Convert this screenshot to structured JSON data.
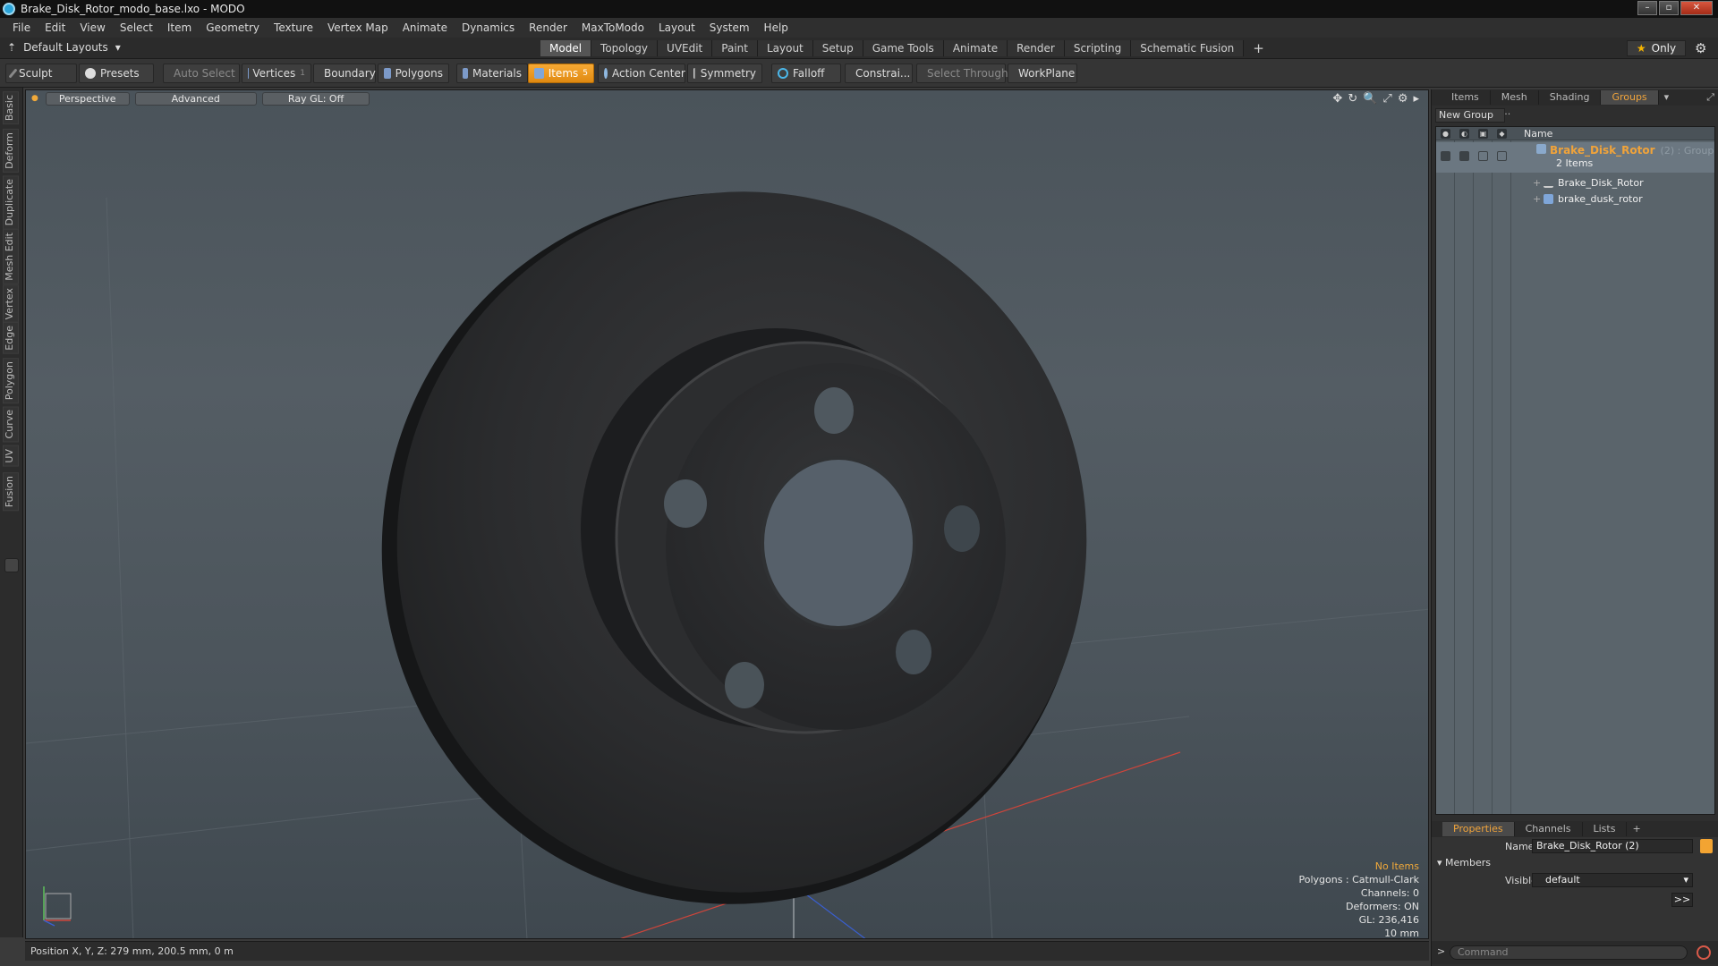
{
  "window": {
    "title": "Brake_Disk_Rotor_modo_base.lxo - MODO",
    "controls": [
      "–",
      "▫",
      "✕"
    ]
  },
  "menu": [
    "File",
    "Edit",
    "View",
    "Select",
    "Item",
    "Geometry",
    "Texture",
    "Vertex Map",
    "Animate",
    "Dynamics",
    "Render",
    "MaxToModo",
    "Layout",
    "System",
    "Help"
  ],
  "layout_bar": {
    "layouts_label": "Default Layouts",
    "tabs": [
      "Model",
      "Topology",
      "UVEdit",
      "Paint",
      "Layout",
      "Setup",
      "Game Tools",
      "Animate",
      "Render",
      "Scripting",
      "Schematic Fusion"
    ],
    "active_tab": "Model",
    "plus": "+",
    "only_label": "Only",
    "gear": "⚙"
  },
  "toolbar": {
    "sculpt": "Sculpt",
    "presets": "Presets",
    "auto_select": "Auto Select",
    "vertices": "Vertices",
    "vertices_count": "1",
    "boundary": "Boundary",
    "polygons": "Polygons",
    "materials": "Materials",
    "items": "Items",
    "items_count": "5",
    "action_center": "Action Center",
    "symmetry": "Symmetry",
    "falloff": "Falloff",
    "constraints": "Constrai...",
    "select_through": "Select Through",
    "workplane": "WorkPlane"
  },
  "left_tabs": [
    "Basic",
    "Deform",
    "Duplicate",
    "Mesh Edit",
    "Vertex",
    "Edge",
    "Polygon",
    "Curve",
    "UV",
    "Fusion"
  ],
  "viewport": {
    "view_label": "Perspective",
    "advanced_label": "Advanced",
    "raygl_label": "Ray GL: Off",
    "tools": [
      "✥",
      "↻",
      "🔍",
      "⤢",
      "⚙",
      "▸"
    ],
    "info": {
      "selection": "No Items",
      "polygons": "Polygons : Catmull-Clark",
      "channels": "Channels: 0",
      "deformers": "Deformers: ON",
      "gl": "GL: 236,416",
      "scale": "10 mm"
    },
    "colors": {
      "accent": "#f0a93a"
    }
  },
  "statusbar": {
    "position": "Position X, Y, Z:   279 mm, 200.5 mm, 0 m"
  },
  "right_panel": {
    "tabs": [
      "Items",
      "Mesh ...",
      "Shading",
      "Groups"
    ],
    "active_tab": "Groups",
    "new_group": "New Group",
    "name_header": "Name",
    "group": {
      "name": "Brake_Disk_Rotor",
      "suffix": "(2) : Group",
      "count": "2 Items",
      "children": [
        "Brake_Disk_Rotor",
        "brake_dusk_rotor"
      ]
    },
    "props_tabs": [
      "Properties",
      "Channels",
      "Lists"
    ],
    "props_active": "Properties",
    "props_plus": "+",
    "name_label": "Name",
    "name_value": "Brake_Disk_Rotor (2)",
    "members_label": "Members",
    "visible_label": "Visible",
    "visible_value": "default",
    "more_button": ">>",
    "command_prompt": ">",
    "command_placeholder": "Command"
  }
}
